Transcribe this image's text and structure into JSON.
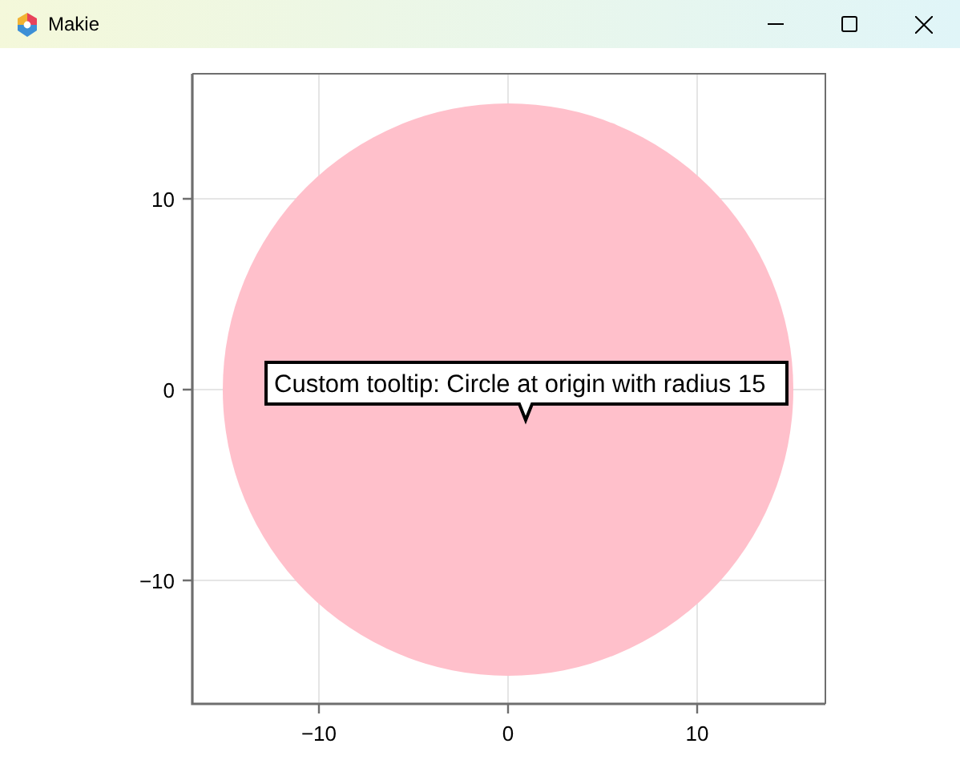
{
  "window": {
    "title": "Makie"
  },
  "plot": {
    "xticks": [
      "−10",
      "0",
      "10"
    ],
    "yticks": [
      "10",
      "0",
      "−10"
    ],
    "tooltip": {
      "text": "Custom tooltip: Circle at origin with radius 15"
    }
  }
}
